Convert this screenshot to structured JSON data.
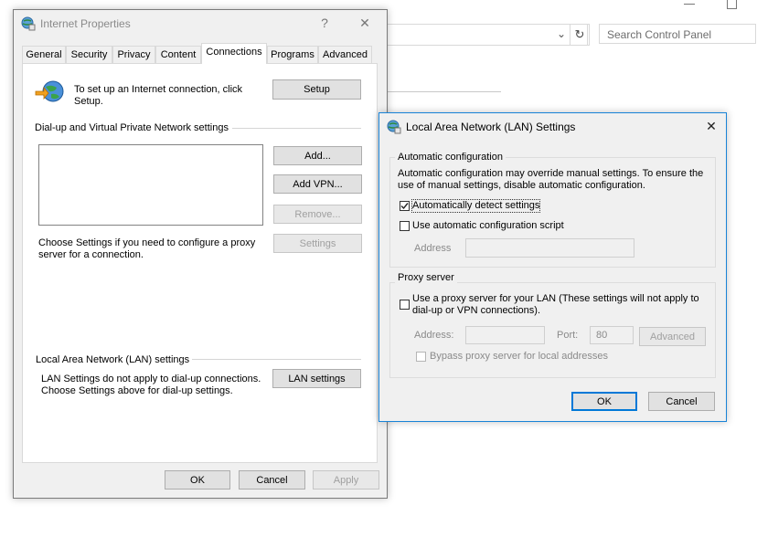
{
  "background": {
    "search_placeholder": "Search Control Panel",
    "refresh_icon": "refresh-icon",
    "chevron_icon": "chevron-down-icon"
  },
  "internet_properties": {
    "title": "Internet Properties",
    "help": "?",
    "close": "✕",
    "tabs": [
      "General",
      "Security",
      "Privacy",
      "Content",
      "Connections",
      "Programs",
      "Advanced"
    ],
    "active_tab": "Connections",
    "setup_text": "To set up an Internet connection, click Setup.",
    "setup_button": "Setup",
    "dialup_header": "Dial-up and Virtual Private Network settings",
    "add_button": "Add...",
    "add_vpn_button": "Add VPN...",
    "remove_button": "Remove...",
    "settings_button": "Settings",
    "proxy_text": "Choose Settings if you need to configure a proxy server for a connection.",
    "lan_header": "Local Area Network (LAN) settings",
    "lan_text": "LAN Settings do not apply to dial-up connections. Choose Settings above for dial-up settings.",
    "lan_settings_button": "LAN settings",
    "ok": "OK",
    "cancel": "Cancel",
    "apply": "Apply"
  },
  "lan_dialog": {
    "title": "Local Area Network (LAN) Settings",
    "close": "✕",
    "auto_config_label": "Automatic configuration",
    "auto_config_text": "Automatic configuration may override manual settings.  To ensure the use of manual settings, disable automatic configuration.",
    "auto_detect_label": "Automatically detect settings",
    "auto_detect_checked": true,
    "auto_script_label": "Use automatic configuration script",
    "auto_script_checked": false,
    "address_label": "Address",
    "address_value": "",
    "proxy_label": "Proxy server",
    "use_proxy_label": "Use a proxy server for your LAN (These settings will not apply to dial-up or VPN connections).",
    "use_proxy_checked": false,
    "proxy_address_label": "Address:",
    "proxy_address_value": "",
    "port_label": "Port:",
    "port_value": "80",
    "advanced_button": "Advanced",
    "bypass_label": "Bypass proxy server for local addresses",
    "bypass_checked": false,
    "ok": "OK",
    "cancel": "Cancel"
  }
}
